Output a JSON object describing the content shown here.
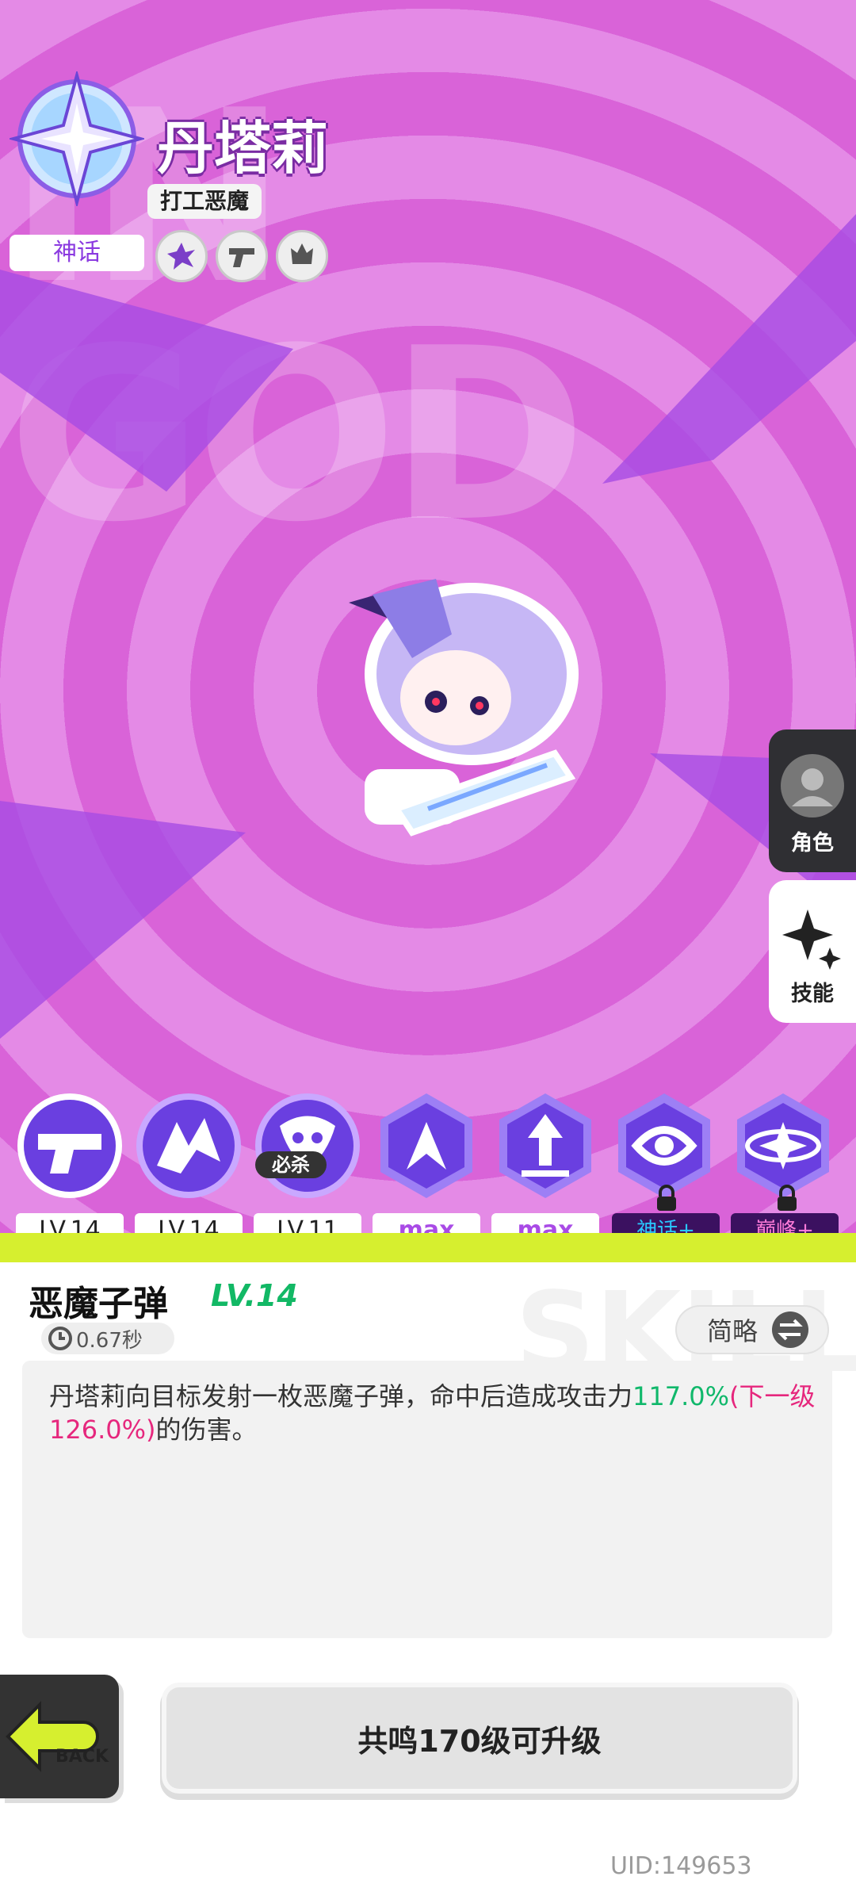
{
  "hero": {
    "name": "丹塔莉",
    "title": "打工恶魔",
    "rarity": "神话",
    "attributes": [
      "burst-icon",
      "gun-icon",
      "flame-icon"
    ]
  },
  "side_tabs": [
    {
      "label": "角色",
      "icon": "avatar-icon"
    },
    {
      "label": "技能",
      "icon": "sparkle-icon"
    }
  ],
  "skills": [
    {
      "level": "LV.14",
      "icon": "pistol-icon"
    },
    {
      "level": "LV.14",
      "icon": "bat-wing-icon"
    },
    {
      "level": "LV.11",
      "icon": "demon-summon-icon",
      "badge": "必杀"
    },
    {
      "level": "max",
      "icon": "triple-arrow-icon"
    },
    {
      "level": "max",
      "icon": "arrow-up-icon"
    },
    {
      "level": "神话+",
      "icon": "vortex-icon",
      "locked": true
    },
    {
      "level": "巅峰+",
      "icon": "star-orbit-icon",
      "locked": true
    }
  ],
  "selected_skill": {
    "name": "恶魔子弹",
    "level": "LV.14",
    "cooldown": "0.67秒",
    "brief_label": "简略",
    "desc_part1": "丹塔莉向目标发射一枚恶魔子弹，命中后造成攻击力",
    "desc_value": "117.0%",
    "desc_next": "(下一级126.0%)",
    "desc_part2": "的伤害。"
  },
  "upgrade_label": "共鸣170级可升级",
  "back_label": "BACK",
  "uid": "UID:149653",
  "colors": {
    "accent": "#d85fd8",
    "green": "#10b86b",
    "pink": "#e6277d",
    "slime": "#d6ef2f"
  }
}
